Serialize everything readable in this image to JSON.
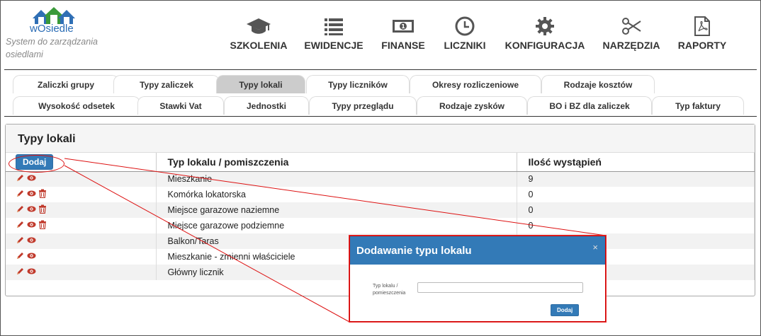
{
  "app": {
    "logo_prefix": "w",
    "logo_name": "Osiedle",
    "tagline": "System do zarządzania osiedlami"
  },
  "nav": [
    {
      "label": "SZKOLENIA",
      "icon": "graduation-cap-icon"
    },
    {
      "label": "EWIDENCJE",
      "icon": "list-icon"
    },
    {
      "label": "FINANSE",
      "icon": "banknote-icon"
    },
    {
      "label": "LICZNIKI",
      "icon": "clock-icon"
    },
    {
      "label": "KONFIGURACJA",
      "icon": "gear-icon"
    },
    {
      "label": "NARZĘDZIA",
      "icon": "scissors-icon"
    },
    {
      "label": "RAPORTY",
      "icon": "pdf-file-icon"
    }
  ],
  "tabs_row1": [
    "Zaliczki grupy",
    "Typy zaliczek",
    "Typy lokali",
    "Typy liczników",
    "Okresy rozliczeniowe",
    "Rodzaje kosztów"
  ],
  "tabs_row2": [
    "Wysokość odsetek",
    "Stawki Vat",
    "Jednostki",
    "Typy przeglądu",
    "Rodzaje zysków",
    "BO i BZ dla zaliczek",
    "Typ faktury"
  ],
  "active_tab": "Typy lokali",
  "panel": {
    "title": "Typy lokali",
    "add_label": "Dodaj",
    "columns": [
      "Typ lokalu / pomiszczenia",
      "Ilość wystąpień"
    ],
    "rows": [
      {
        "name": "Mieszkanie",
        "count": "9",
        "deletable": false
      },
      {
        "name": "Komórka lokatorska",
        "count": "0",
        "deletable": true
      },
      {
        "name": "Miejsce garazowe naziemne",
        "count": "0",
        "deletable": true
      },
      {
        "name": "Miejsce garazowe podziemne",
        "count": "0",
        "deletable": true
      },
      {
        "name": "Balkon/Taras",
        "count": "",
        "deletable": false
      },
      {
        "name": "Mieszkanie - zmienni właściciele",
        "count": "",
        "deletable": false
      },
      {
        "name": "Główny licznik",
        "count": "",
        "deletable": false
      }
    ]
  },
  "dialog": {
    "title": "Dodawanie typu lokalu",
    "close": "×",
    "field_label": "Typ lokalu / pomieszczenia",
    "field_value": "",
    "submit_label": "Dodaj"
  },
  "colors": {
    "primary": "#337ab7",
    "annotation": "#dd1111",
    "active_tab": "#cccccc"
  }
}
